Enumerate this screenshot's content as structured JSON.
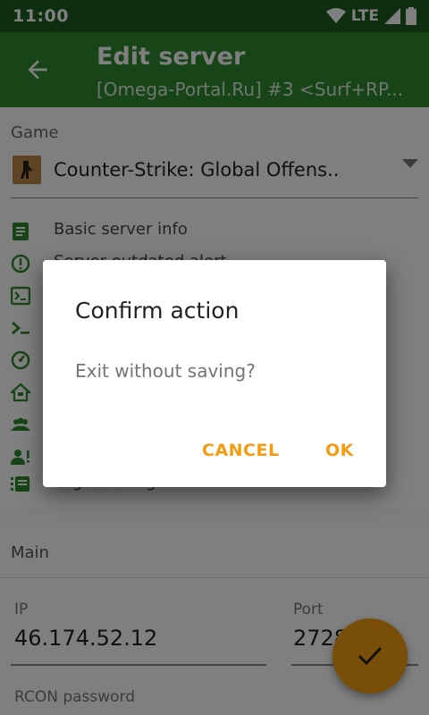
{
  "status_bar": {
    "time": "11:00",
    "network": "LTE"
  },
  "app_bar": {
    "title": "Edit server",
    "subtitle": "[Omega-Portal.Ru] #3 <Surf+RP..."
  },
  "game": {
    "label": "Game",
    "value": "Counter-Strike: Global Offens.."
  },
  "menu_items": [
    {
      "label": "Basic server info",
      "icon": "document-icon"
    },
    {
      "label": "Server outdated alert",
      "icon": "alert-icon"
    },
    {
      "label": "",
      "icon": "console-icon"
    },
    {
      "label": "",
      "icon": "terminal-icon"
    },
    {
      "label": "",
      "icon": "gauge-icon"
    },
    {
      "label": "",
      "icon": "home-icon"
    },
    {
      "label": "",
      "icon": "group-icon"
    },
    {
      "label": "",
      "icon": "user-alert-icon"
    },
    {
      "label": "Log listening",
      "icon": "list-icon"
    }
  ],
  "main": {
    "section_label": "Main",
    "ip_label": "IP",
    "ip_value": "46.174.52.12",
    "port_label": "Port",
    "port_value": "2728",
    "rcon_label": "RCON password"
  },
  "dialog": {
    "title": "Confirm action",
    "message": "Exit without saving?",
    "cancel_label": "CANCEL",
    "ok_label": "OK"
  },
  "colors": {
    "primary": "#2e8b2e",
    "primary_dark": "#1d5e1f",
    "accent": "#f39c12"
  }
}
